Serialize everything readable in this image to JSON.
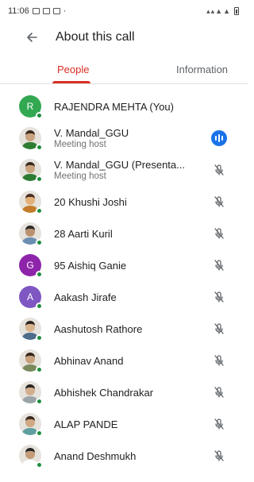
{
  "status_bar": {
    "time": "11:06",
    "left_icons": [
      "photo-icon",
      "gallery-icon",
      "download-icon"
    ],
    "separator": "·"
  },
  "header": {
    "title": "About this call",
    "back_icon": "arrow-back-icon"
  },
  "tabs": [
    {
      "label": "People",
      "active": true
    },
    {
      "label": "Information",
      "active": false
    }
  ],
  "colors": {
    "accent": "#d93025",
    "online_dot": "#1e8e3e",
    "speaking": "#1a73e8"
  },
  "participants": [
    {
      "name": "RAJENDRA MEHTA (You)",
      "subtitle": "",
      "avatar": {
        "type": "letter",
        "letter": "R",
        "color": "#33a852"
      },
      "status": "none"
    },
    {
      "name": "V. Mandal_GGU",
      "subtitle": "Meeting host",
      "avatar": {
        "type": "photo"
      },
      "status": "speaking"
    },
    {
      "name": "V. Mandal_GGU (Presenta...",
      "subtitle": "Meeting host",
      "avatar": {
        "type": "photo"
      },
      "status": "muted"
    },
    {
      "name": "20 Khushi Joshi",
      "subtitle": "",
      "avatar": {
        "type": "photo"
      },
      "status": "muted"
    },
    {
      "name": "28 Aarti Kuril",
      "subtitle": "",
      "avatar": {
        "type": "photo"
      },
      "status": "muted"
    },
    {
      "name": "95 Aishiq Ganie",
      "subtitle": "",
      "avatar": {
        "type": "letter",
        "letter": "G",
        "color": "#8e24aa"
      },
      "status": "muted"
    },
    {
      "name": "Aakash Jirafe",
      "subtitle": "",
      "avatar": {
        "type": "letter",
        "letter": "A",
        "color": "#7e57c2"
      },
      "status": "muted"
    },
    {
      "name": "Aashutosh Rathore",
      "subtitle": "",
      "avatar": {
        "type": "photo"
      },
      "status": "muted"
    },
    {
      "name": "Abhinav Anand",
      "subtitle": "",
      "avatar": {
        "type": "photo"
      },
      "status": "muted"
    },
    {
      "name": "Abhishek Chandrakar",
      "subtitle": "",
      "avatar": {
        "type": "photo"
      },
      "status": "muted"
    },
    {
      "name": "ALAP PANDE",
      "subtitle": "",
      "avatar": {
        "type": "photo"
      },
      "status": "muted"
    },
    {
      "name": "Anand Deshmukh",
      "subtitle": "",
      "avatar": {
        "type": "photo"
      },
      "status": "muted"
    }
  ]
}
